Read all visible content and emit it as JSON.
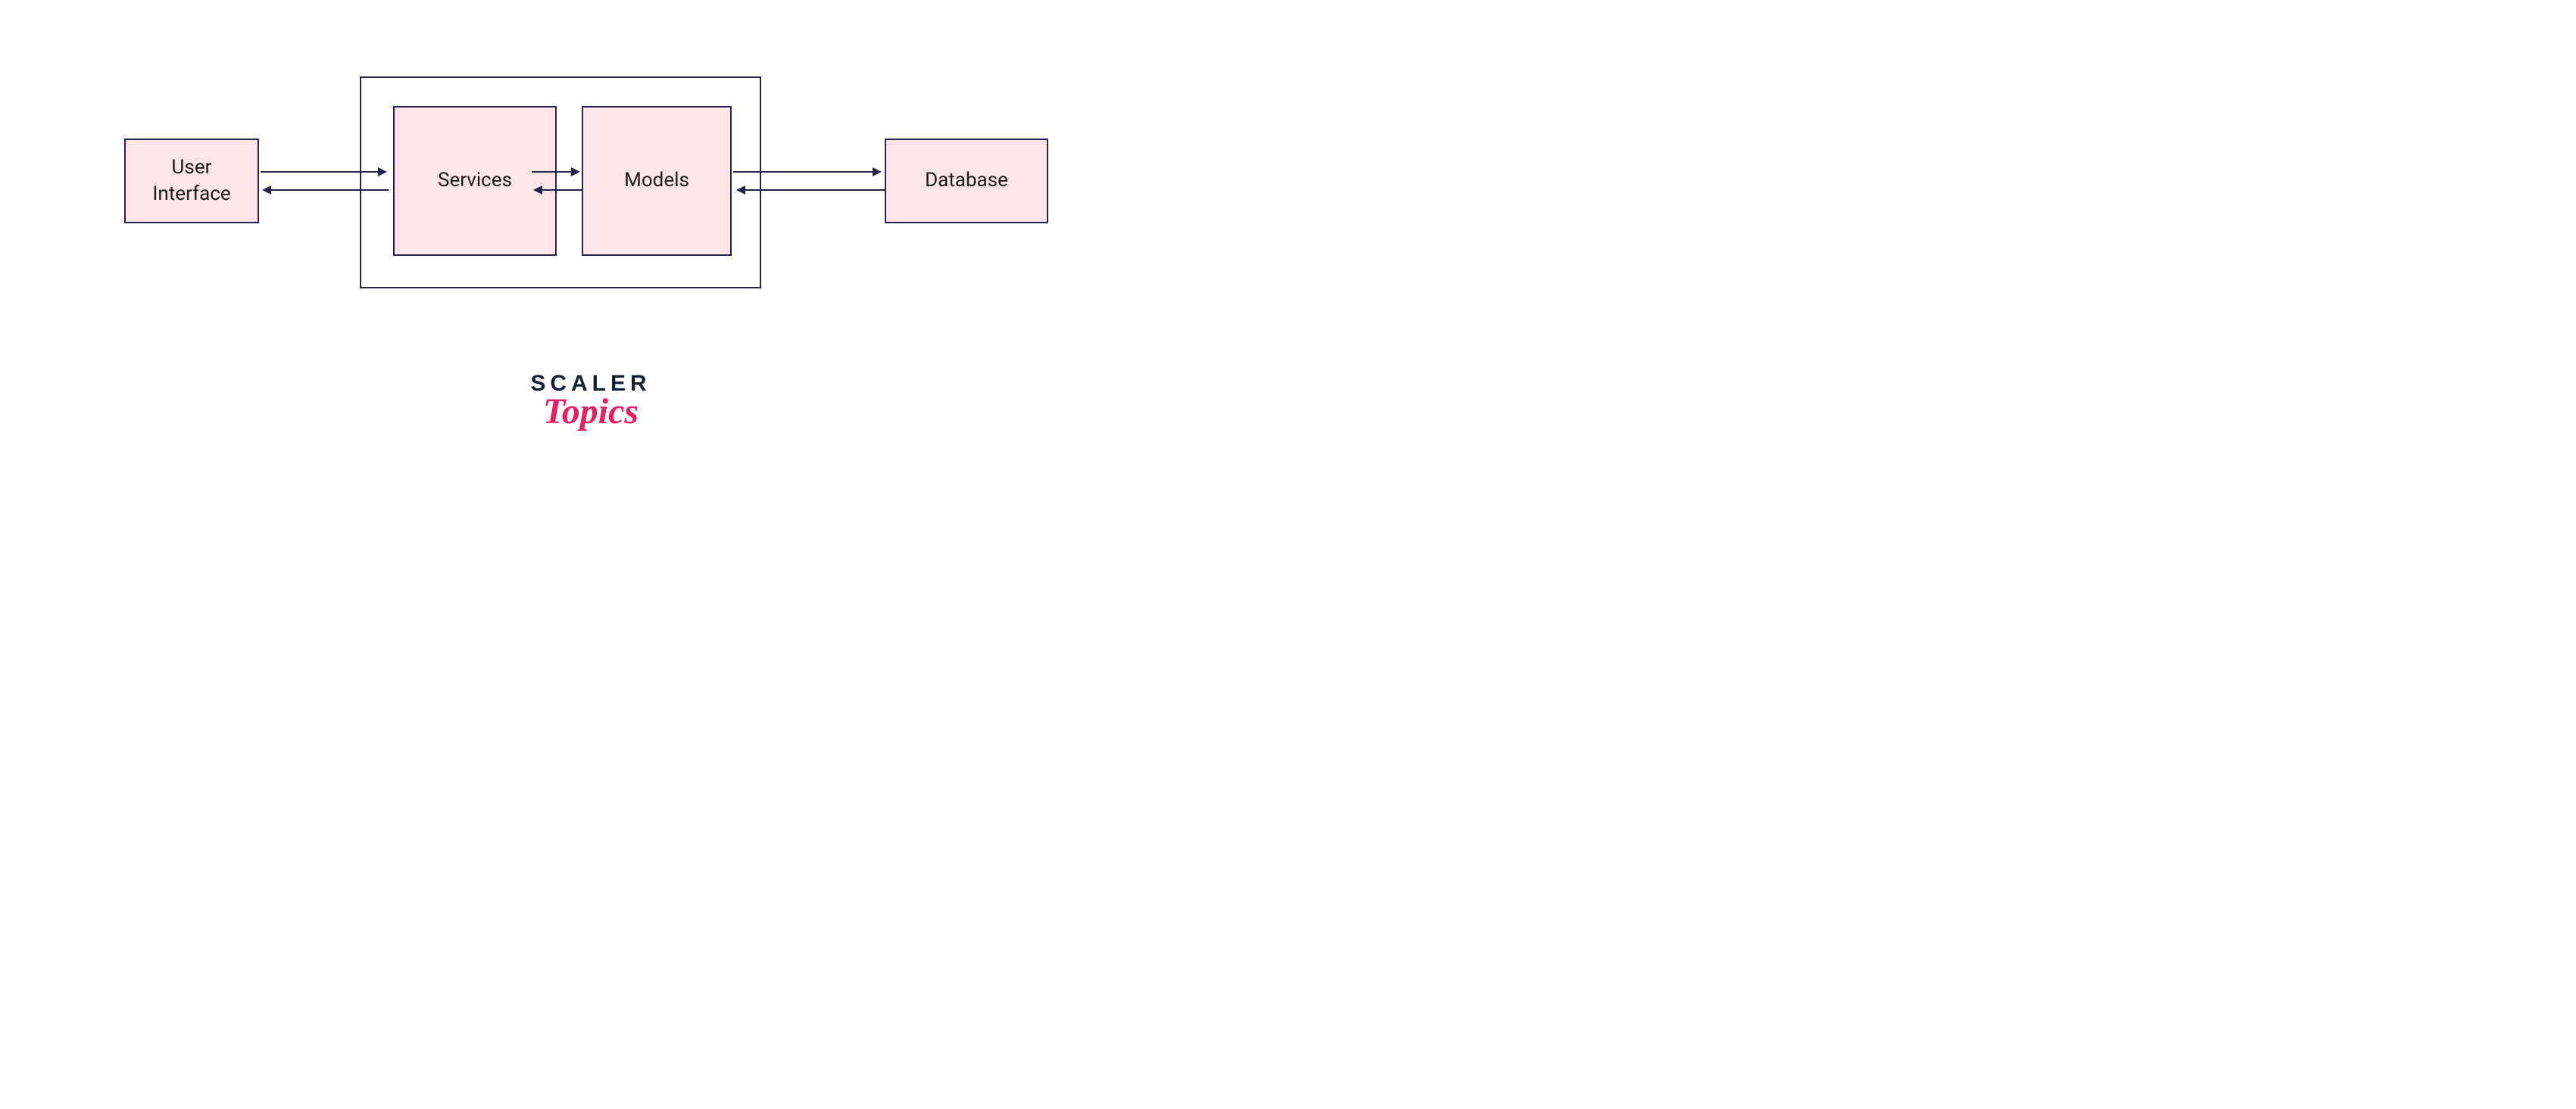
{
  "boxes": {
    "user_interface": "User\nInterface",
    "services": "Services",
    "models": "Models",
    "database": "Database"
  },
  "logo": {
    "line1": "SCALER",
    "line2": "Topics"
  },
  "colors": {
    "box_fill": "#fce4e8",
    "border": "#24234b",
    "logo_top": "#172030",
    "logo_bottom": "#e91e63"
  }
}
